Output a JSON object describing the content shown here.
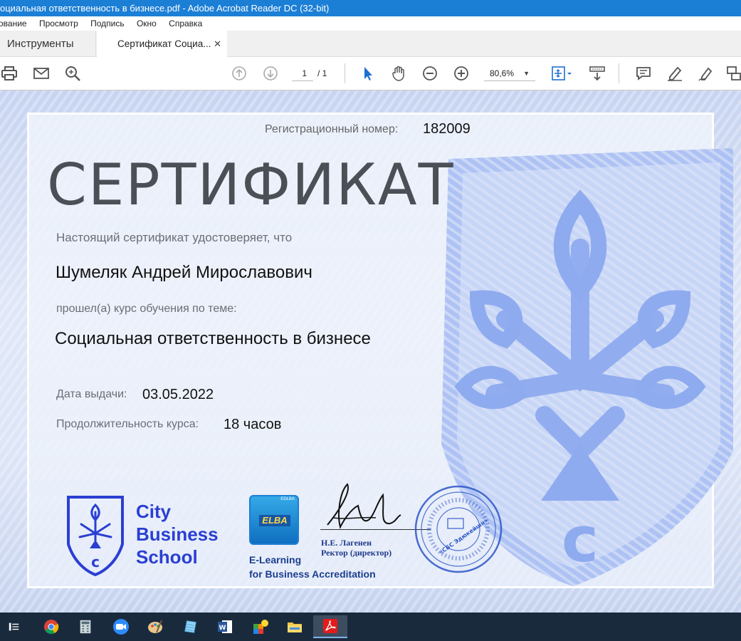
{
  "window": {
    "title": "оциальная ответственность в бизнесе.pdf - Adobe Acrobat Reader DC (32-bit)"
  },
  "menu": {
    "items": [
      "ование",
      "Просмотр",
      "Подпись",
      "Окно",
      "Справка"
    ]
  },
  "tabs": {
    "tools_label": "Инструменты",
    "doc_label": "Сертификат Социа...",
    "close_glyph": "✕"
  },
  "toolbar": {
    "page_current": "1",
    "page_total": "/  1",
    "zoom_value": "80,6%",
    "zoom_caret": "▼",
    "icons": [
      "print-icon",
      "mail-icon",
      "search-icon",
      "page-up-icon",
      "page-down-icon",
      "select-pointer-icon",
      "hand-icon",
      "zoom-out-icon",
      "zoom-in-icon",
      "fit-page-icon",
      "scroll-mode-icon",
      "comment-icon",
      "highlight-icon",
      "sign-icon",
      "more-tools-icon"
    ]
  },
  "certificate": {
    "reg_label": "Регистрационный номер:",
    "reg_number": "182009",
    "title": "СЕРТИФИКАТ",
    "intro": "Настоящий сертификат удостоверяет, что",
    "full_name": "Шумеляк Андрей Мирославович",
    "passed": "прошел(а) курс обучения по теме:",
    "course": "Социальная ответственность в бизнесе",
    "date_label": "Дата выдачи:",
    "date_value": "03.05.2022",
    "duration_label": "Продолжительность курса:",
    "duration_value": "18 часов",
    "cbs": {
      "line1": "City",
      "line2": "Business",
      "line3": "School"
    },
    "elba": {
      "tag": "EDLBA",
      "mark": "ELBA",
      "line1": "E-Learning",
      "line2": "for Business Accreditation"
    },
    "signer": {
      "name": "Н.Е. Лагенен",
      "role": "Ректор (директор)"
    },
    "stamp_text": "«СБС Эдюкейшн»"
  },
  "taskbar": {
    "icons": [
      "task-view-icon",
      "chrome-icon",
      "calculator-icon",
      "zoom-icon",
      "paint-icon",
      "notepad-icon",
      "word-icon",
      "app-icon",
      "file-explorer-icon",
      "acrobat-icon"
    ]
  },
  "colors": {
    "titlebar": "#1c7fd6",
    "cbs_blue": "#2a3fd2",
    "taskbar": "#1a2a3d"
  }
}
